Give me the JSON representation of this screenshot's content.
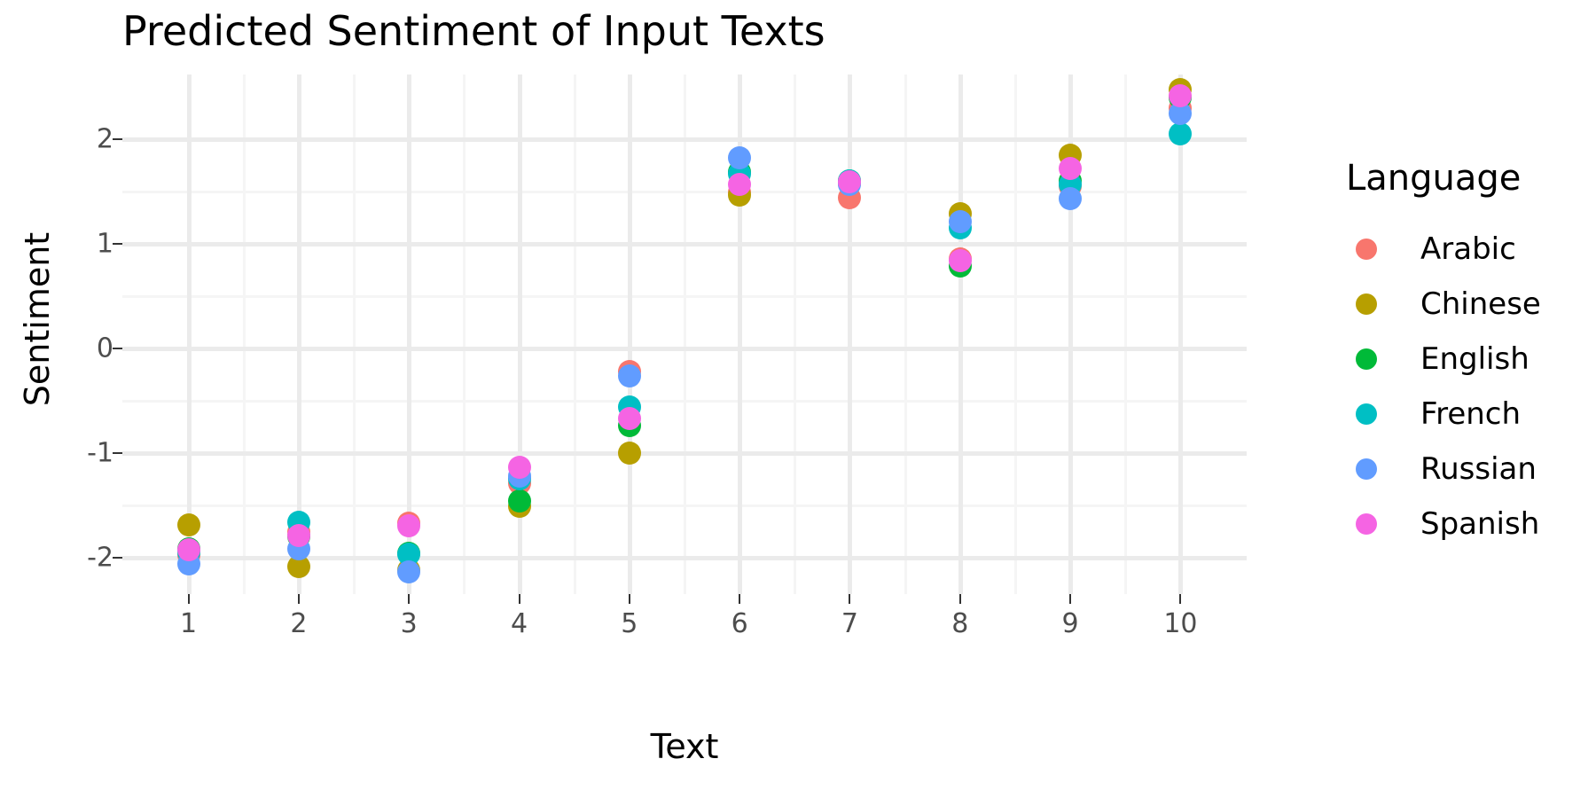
{
  "chart_data": {
    "type": "scatter",
    "title": "Predicted Sentiment of Input Texts",
    "xlabel": "Text",
    "ylabel": "Sentiment",
    "grid": true,
    "legend_position": "right",
    "legend_title": "Language",
    "x": [
      1,
      2,
      3,
      4,
      5,
      6,
      7,
      8,
      9,
      10
    ],
    "xticklabels": [
      "1",
      "2",
      "3",
      "4",
      "5",
      "6",
      "7",
      "8",
      "9",
      "10"
    ],
    "yticklabels": [
      "2",
      "1",
      "0",
      "-1",
      "-2"
    ],
    "ytickvalues": [
      2,
      1,
      0,
      -1,
      -2
    ],
    "xlim": [
      0.4,
      10.6
    ],
    "ylim": [
      -2.35,
      2.62
    ],
    "series": [
      {
        "name": "Arabic",
        "color": "#F8766D",
        "values": [
          -1.98,
          -1.76,
          -1.67,
          -1.29,
          -0.22,
          1.49,
          1.44,
          0.86,
          1.55,
          2.3
        ]
      },
      {
        "name": "Chinese",
        "color": "#B79F00",
        "values": [
          -1.69,
          -2.09,
          -2.12,
          -1.51,
          -1.0,
          1.47,
          1.58,
          1.29,
          1.85,
          2.48
        ]
      },
      {
        "name": "English",
        "color": "#00BA38",
        "values": [
          -1.92,
          -1.8,
          -1.96,
          -1.46,
          -0.74,
          1.69,
          1.6,
          0.79,
          1.6,
          2.4
        ]
      },
      {
        "name": "French",
        "color": "#00BFC4",
        "values": [
          -1.95,
          -1.66,
          -1.97,
          -1.25,
          -0.56,
          1.67,
          1.6,
          1.15,
          1.57,
          2.05
        ]
      },
      {
        "name": "Russian",
        "color": "#619CFF",
        "values": [
          -2.06,
          -1.92,
          -2.14,
          -1.22,
          -0.26,
          1.82,
          1.57,
          1.21,
          1.43,
          2.25
        ]
      },
      {
        "name": "Spanish",
        "color": "#F564E3",
        "values": [
          -1.93,
          -1.79,
          -1.7,
          -1.14,
          -0.67,
          1.57,
          1.59,
          0.84,
          1.72,
          2.42
        ]
      }
    ]
  },
  "axis": {
    "minor_y": [
      1.5,
      0.5,
      -0.5,
      -1.5
    ],
    "minor_x": [
      1.5,
      2.5,
      3.5,
      4.5,
      5.5,
      6.5,
      7.5,
      8.5,
      9.5
    ]
  }
}
